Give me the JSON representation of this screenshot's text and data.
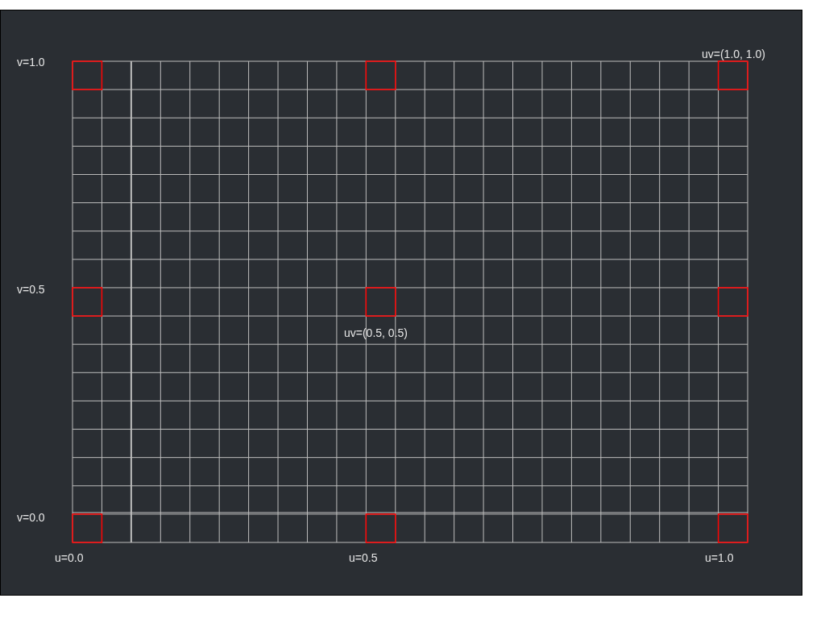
{
  "labels": [
    {
      "text": "v=1.0"
    },
    {
      "text": "v=0.5"
    },
    {
      "text": "v=0.0"
    },
    {
      "text": "u=0.0"
    },
    {
      "text": "u=0.5"
    },
    {
      "text": "u=1.0"
    },
    {
      "text": "uv=(1.0, 1.0)"
    },
    {
      "text": "uv=(0.5, 0.5)"
    }
  ]
}
